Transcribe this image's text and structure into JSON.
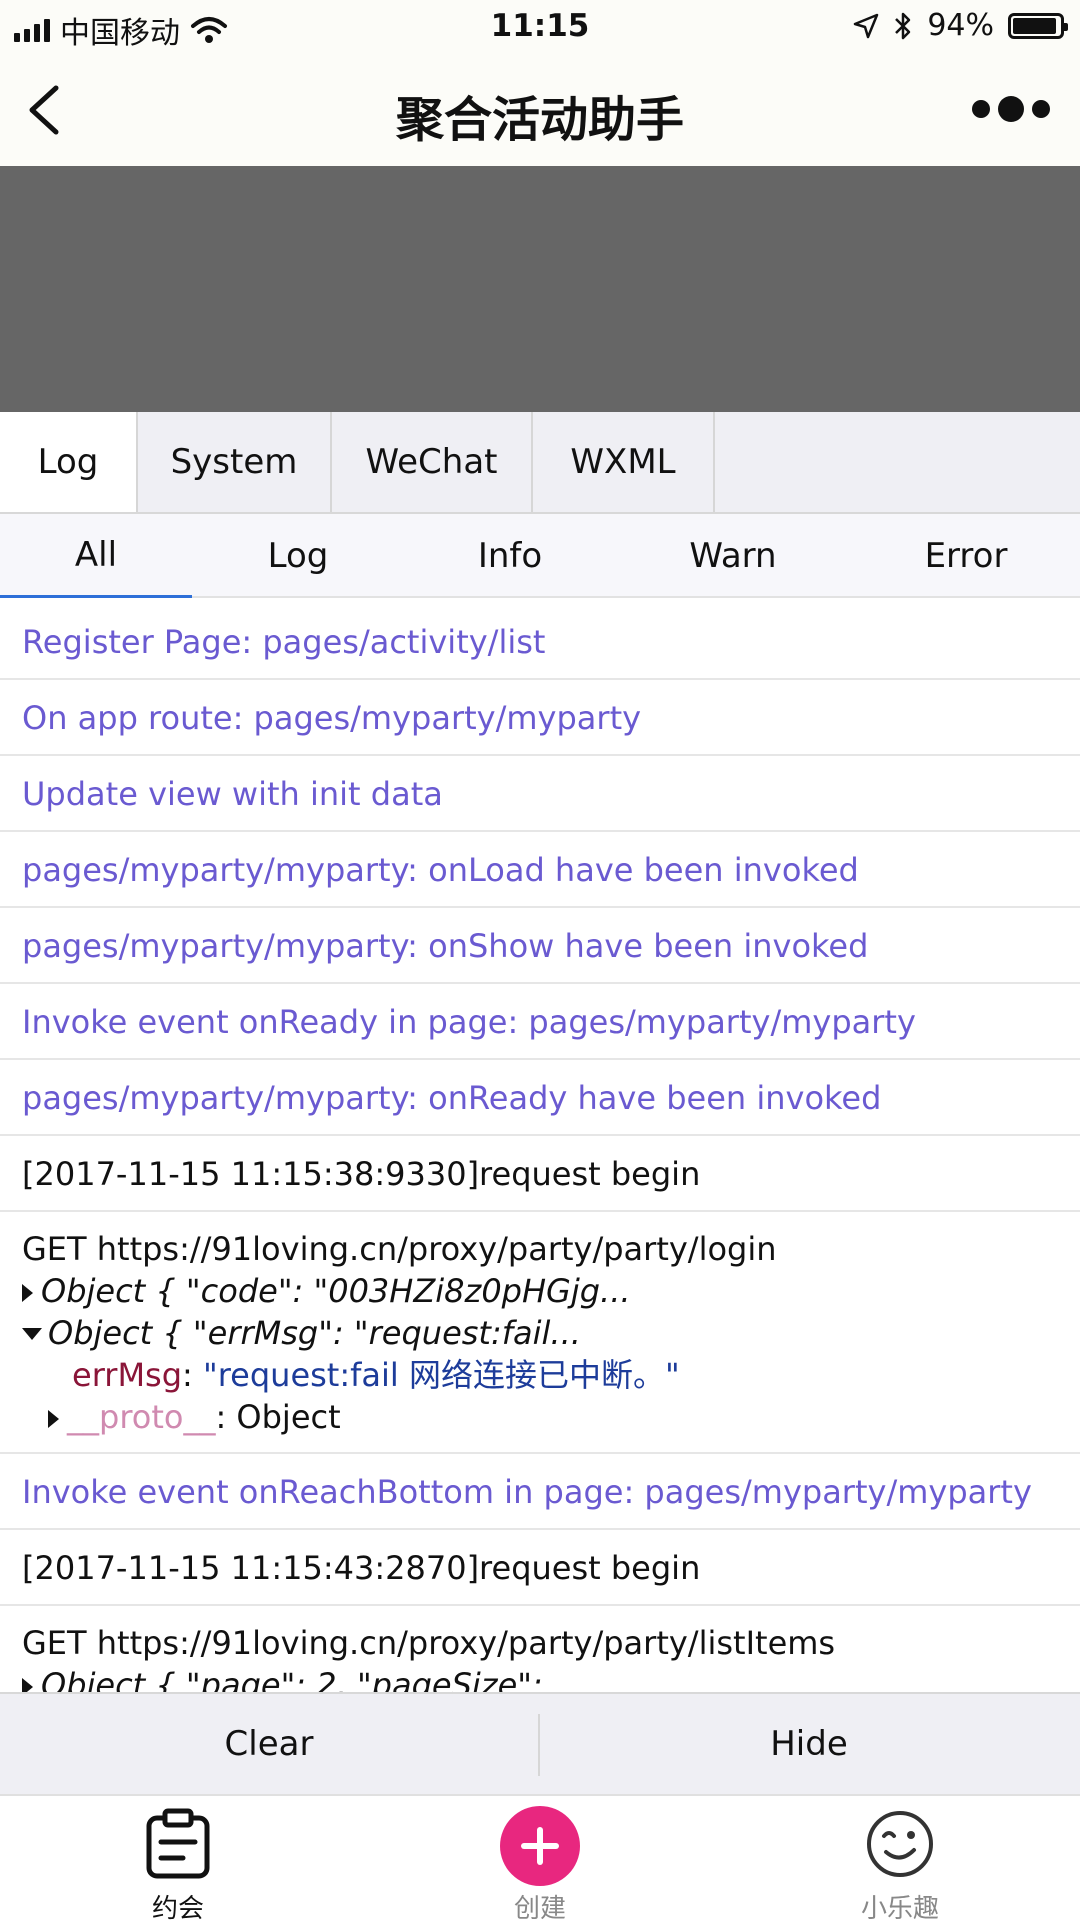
{
  "status_bar": {
    "carrier": "中国移动",
    "time": "11:15",
    "battery_percent": "94%",
    "battery_level": 0.94
  },
  "nav": {
    "title": "聚合活动助手"
  },
  "console_tabs": [
    "Log",
    "System",
    "WeChat",
    "WXML"
  ],
  "filter_tabs": [
    "All",
    "Log",
    "Info",
    "Warn",
    "Error"
  ],
  "logs": {
    "l1": "Register Page: pages/activity/list",
    "l2": "On app route: pages/myparty/myparty",
    "l3": "Update view with init data",
    "l4": "pages/myparty/myparty: onLoad have been invoked",
    "l5": "pages/myparty/myparty: onShow have been invoked",
    "l6": "Invoke event onReady in page: pages/myparty/myparty",
    "l7": "pages/myparty/myparty: onReady have been invoked",
    "l8": "[2017-11-15 11:15:38:9330]request begin",
    "l9": {
      "line": "GET https://91loving.cn/proxy/party/party/login",
      "obj1": "Object { \"code\": \"003HZi8z0pHGjg...",
      "obj2": "Object { \"errMsg\": \"request:fail...",
      "err_key": "errMsg",
      "err_val": "\"request:fail 网络连接已中断。\"",
      "proto_key": "__proto__",
      "proto_val": ": Object"
    },
    "l10": "Invoke event onReachBottom in page: pages/myparty/myparty",
    "l11": "[2017-11-15 11:15:43:2870]request begin",
    "l12": {
      "line": "GET https://91loving.cn/proxy/party/party/listItems",
      "obj1": "Object { \"page\": 2, \"pageSize\":"
    }
  },
  "actions": {
    "clear": "Clear",
    "hide": "Hide"
  },
  "tab_bar": {
    "items": [
      {
        "label": "约会",
        "icon": "clipboard-icon",
        "active": true
      },
      {
        "label": "创建",
        "icon": "plus-icon",
        "active": false
      },
      {
        "label": "小乐趣",
        "icon": "wink-face-icon",
        "active": false
      }
    ]
  },
  "colors": {
    "log_purple": "#6a5ad1",
    "active_underline": "#2d6fd8",
    "create_button": "#e8277f",
    "banner_gray": "#666666"
  }
}
